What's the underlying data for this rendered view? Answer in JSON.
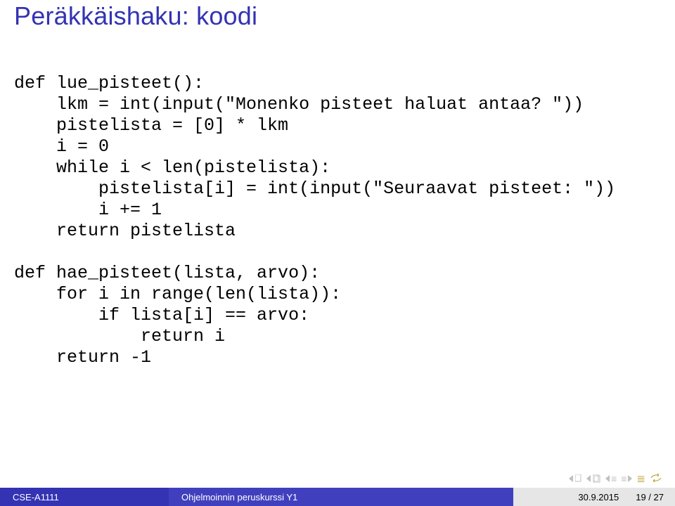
{
  "title": "Peräkkäishaku: koodi",
  "code1": "def lue_pisteet():\n    lkm = int(input(\"Monenko pisteet haluat antaa? \"))\n    pistelista = [0] * lkm\n    i = 0\n    while i < len(pistelista):\n        pistelista[i] = int(input(\"Seuraavat pisteet: \"))\n        i += 1\n    return pistelista",
  "code2": "def hae_pisteet(lista, arvo):\n    for i in range(len(lista)):\n        if lista[i] == arvo:\n            return i\n    return -1",
  "footer": {
    "left": "CSE-A1111",
    "mid": "Ohjelmoinnin peruskurssi Y1",
    "date": "30.9.2015",
    "page": "19 / 27"
  }
}
